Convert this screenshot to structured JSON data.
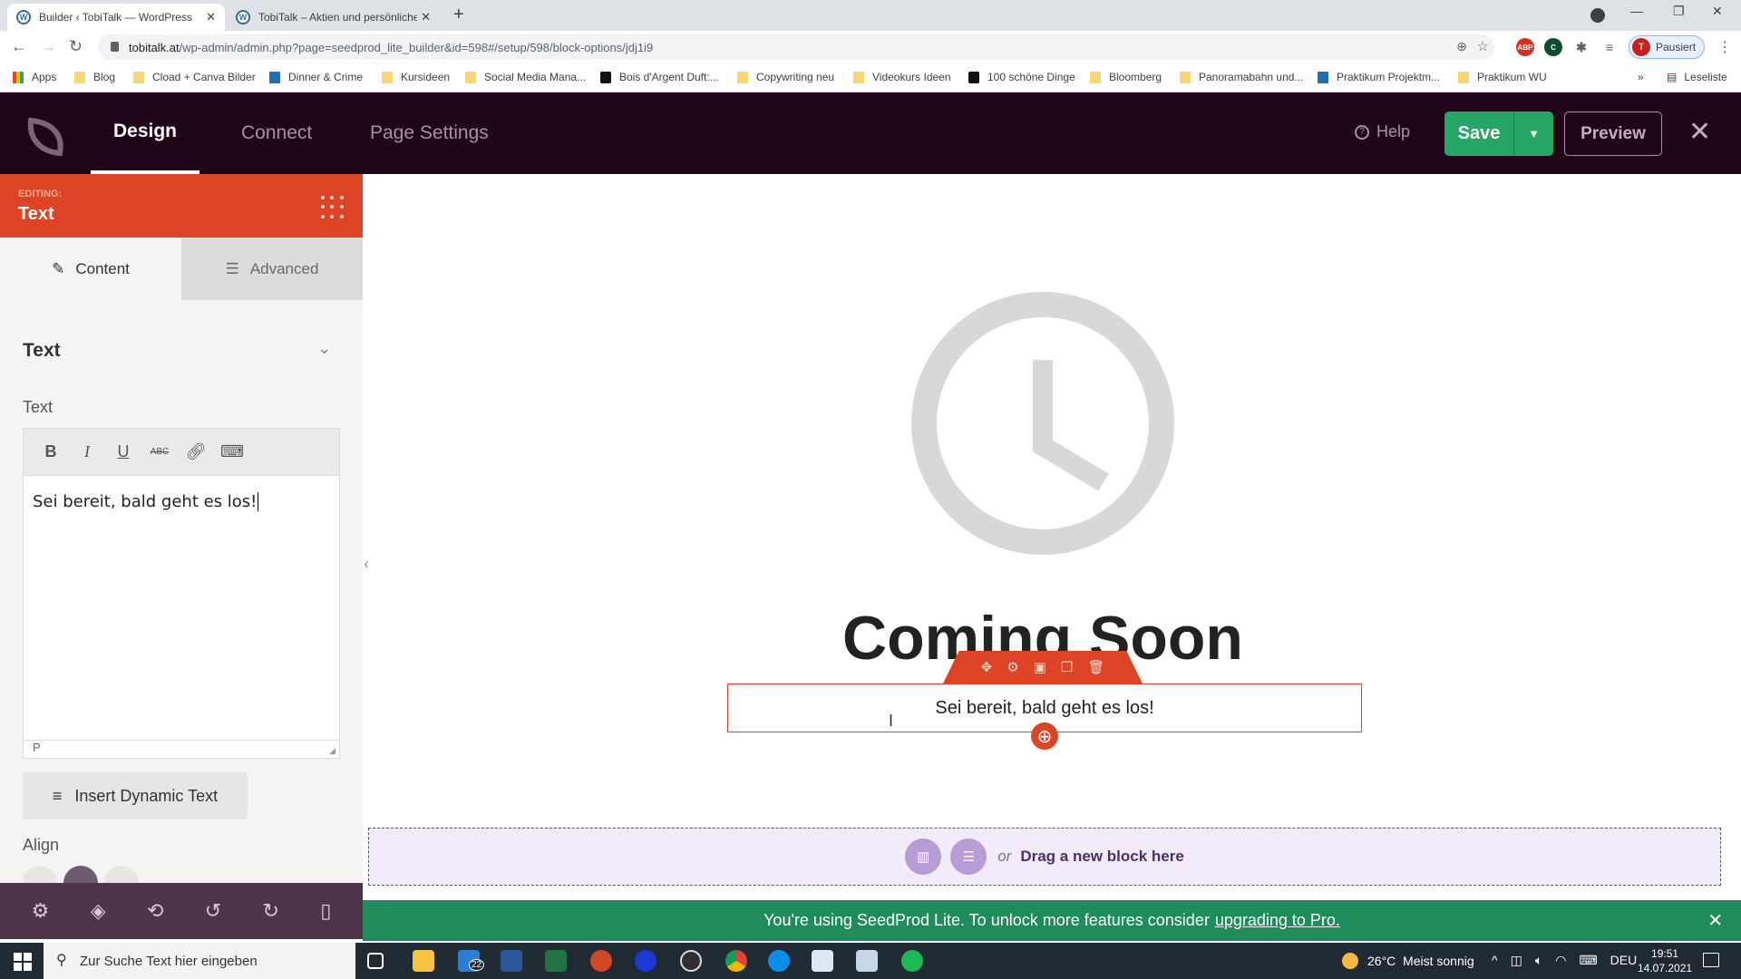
{
  "browser": {
    "tabs": [
      {
        "title": "Builder ‹ TobiTalk — WordPress",
        "active": true
      },
      {
        "title": "TobiTalk – Aktien und persönliche",
        "active": false
      }
    ],
    "url_host": "tobitalk.at",
    "url_path": "/wp-admin/admin.php?page=seedprod_lite_builder&id=598#/setup/598/block-options/jdj1i9",
    "profile_label": "Pausiert",
    "profile_initial": "T",
    "extensions": [
      "ABP",
      "C"
    ],
    "bookmarks": [
      "Apps",
      "Blog",
      "Cload + Canva Bilder",
      "Dinner & Crime",
      "Kursideen",
      "Social Media Mana...",
      "Bois d'Argent Duft:...",
      "Copywriting neu",
      "Videokurs Ideen",
      "100 schöne Dinge",
      "Bloomberg",
      "Panoramabahn und...",
      "Praktikum Projektm...",
      "Praktikum WU"
    ],
    "more_bookmarks": "»",
    "reading_list": "Leseliste"
  },
  "header": {
    "nav": [
      "Design",
      "Connect",
      "Page Settings"
    ],
    "active_nav": "Design",
    "help": "Help",
    "save": "Save",
    "preview": "Preview"
  },
  "sidebar": {
    "editing_label": "EDITING:",
    "editing_block": "Text",
    "tabs": [
      "Content",
      "Advanced"
    ],
    "active_tab": "Content",
    "section_title": "Text",
    "field_label": "Text",
    "editor_value": "Sei bereit, bald geht es los!",
    "editor_status": "P",
    "insert_dynamic": "Insert Dynamic Text",
    "align_label": "Align",
    "align_selected": "center"
  },
  "canvas": {
    "heading": "Coming Soon",
    "text_block": "Sei bereit, bald geht es los!",
    "dropzone_or": "or",
    "dropzone_text": "Drag a new block here"
  },
  "notice": {
    "text": "You're using SeedProd Lite. To unlock more features consider",
    "link": "upgrading to Pro."
  },
  "taskbar": {
    "search_placeholder": "Zur Suche Text hier eingeben",
    "mail_badge": "22",
    "weather": "26°C  Meist sonnig",
    "language": "DEU",
    "time": "19:51",
    "date": "14.07.2021"
  },
  "colors": {
    "header_bg": "#200618",
    "accent": "#dc4425",
    "save_green": "#25a566",
    "notice_green": "#208c5c"
  }
}
